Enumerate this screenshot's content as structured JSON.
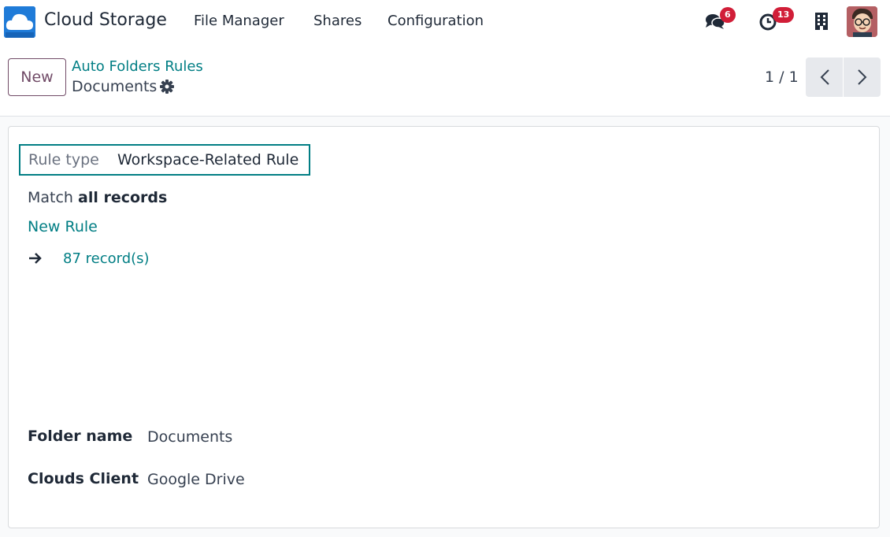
{
  "navbar": {
    "app_name": "Cloud Storage",
    "menu": [
      "File Manager",
      "Shares",
      "Configuration"
    ],
    "messages_count": "6",
    "activities_count": "13",
    "icons": {
      "logo": "cloud-logo-icon",
      "messages": "chat-bubbles-icon",
      "activities": "clock-icon",
      "company": "building-icon",
      "user": "avatar"
    }
  },
  "control_panel": {
    "new_button": "New",
    "breadcrumb_parent": "Auto Folders Rules",
    "breadcrumb_current": "Documents",
    "pager_value": "1 / 1"
  },
  "form": {
    "rule_type_label": "Rule type",
    "rule_type_value": "Workspace-Related Rule",
    "match_prefix": "Match ",
    "match_strong": "all records",
    "new_rule": "New Rule",
    "records": "87 record(s)",
    "folder_name_label": "Folder name",
    "folder_name_value": "Documents",
    "clouds_client_label": "Clouds Client",
    "clouds_client_value": "Google Drive"
  },
  "colors": {
    "brand": "#714b67",
    "link": "#017e84",
    "badge": "#d11e38",
    "logo": "#1f7bd8"
  }
}
